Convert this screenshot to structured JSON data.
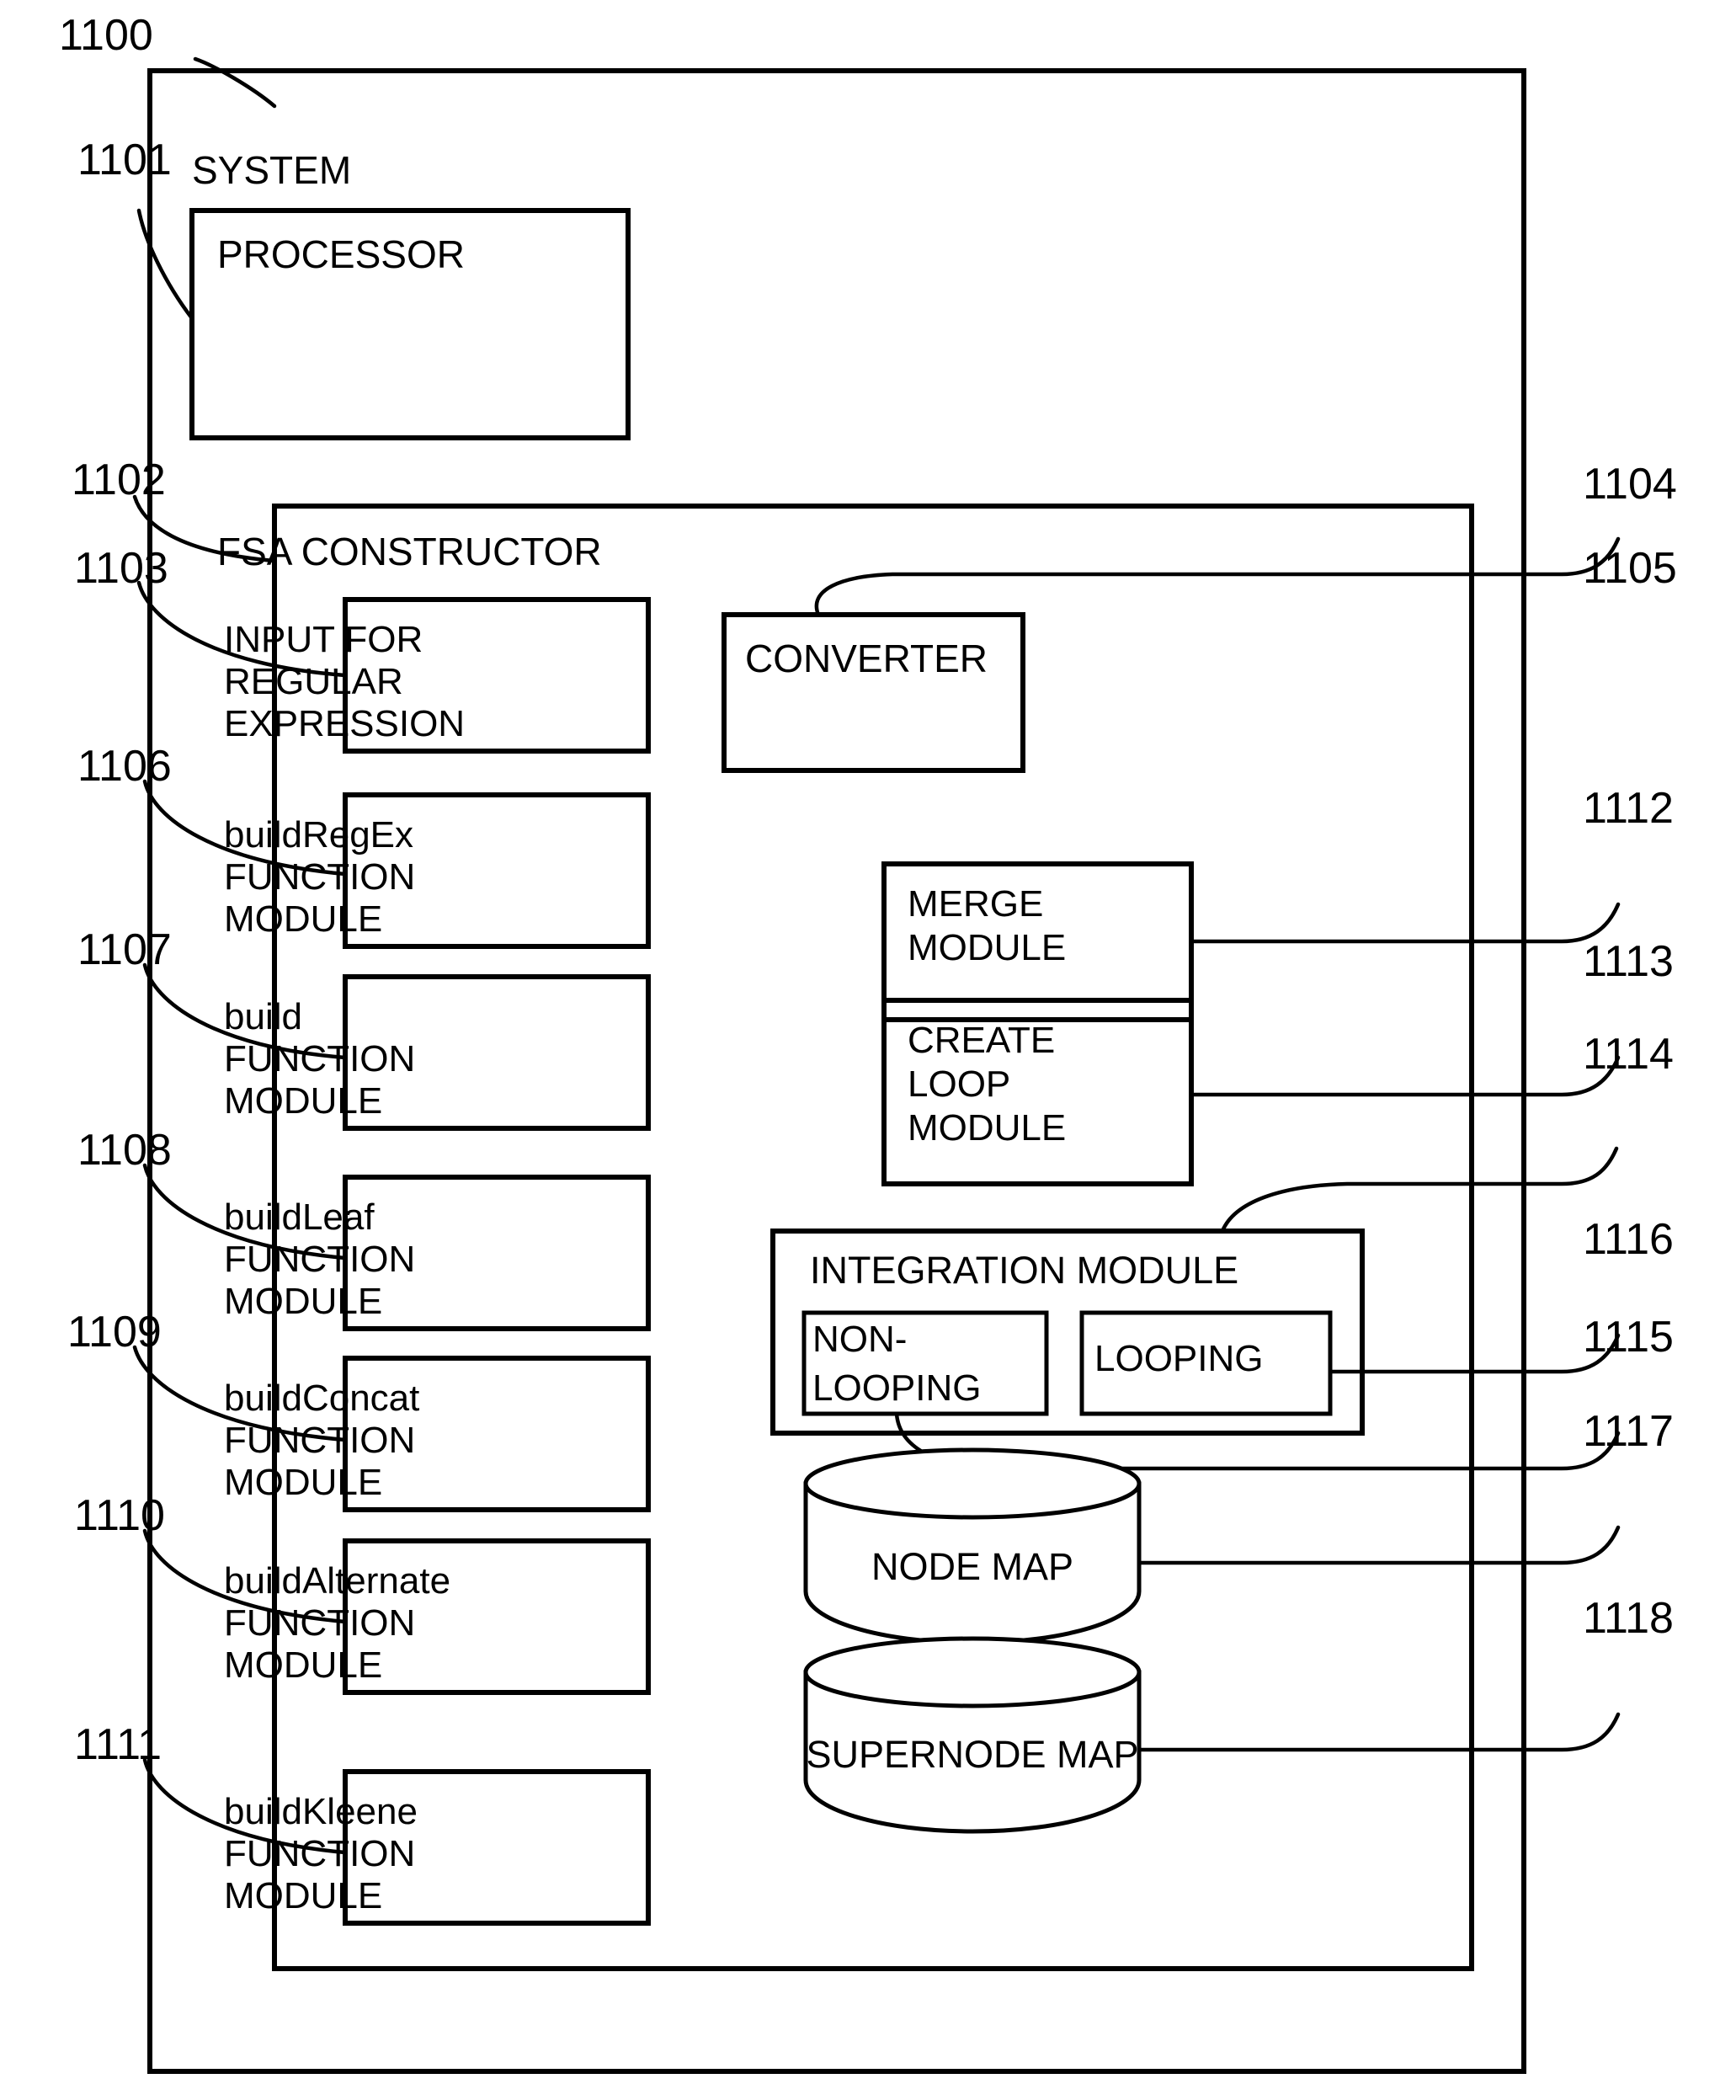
{
  "figure": {
    "type": "patent-block-diagram",
    "figure_number_label": "1100"
  },
  "outer": {
    "ref": "1100",
    "title": "SYSTEM"
  },
  "processor": {
    "ref": "1101",
    "title": "PROCESSOR"
  },
  "fsa_constructor": {
    "ref": "1102",
    "title": "FSA CONSTRUCTOR"
  },
  "left_column": [
    {
      "ref": "1103",
      "lines": [
        "INPUT FOR",
        "REGULAR",
        "EXPRESSION"
      ]
    },
    {
      "ref": "1106",
      "lines": [
        "buildRegEx",
        "FUNCTION",
        "MODULE"
      ]
    },
    {
      "ref": "1107",
      "lines": [
        "build",
        "FUNCTION",
        "MODULE"
      ]
    },
    {
      "ref": "1108",
      "lines": [
        "buildLeaf",
        "FUNCTION",
        "MODULE"
      ]
    },
    {
      "ref": "1109",
      "lines": [
        "buildConcat",
        "FUNCTION",
        "MODULE"
      ]
    },
    {
      "ref": "1110",
      "lines": [
        "buildAlternate",
        "FUNCTION",
        "MODULE"
      ]
    },
    {
      "ref": "1111",
      "lines": [
        "buildKleene",
        "FUNCTION",
        "MODULE"
      ]
    }
  ],
  "right_column": [
    {
      "ref": "1104",
      "lines": [
        "CONVERTER"
      ]
    },
    {
      "ref": "1112",
      "lines": [
        "MERGE",
        "MODULE"
      ]
    },
    {
      "ref": "1113",
      "lines": [
        "CREATE",
        "LOOP",
        "MODULE"
      ]
    }
  ],
  "integration_module": {
    "ref": "1114",
    "title": "INTEGRATION MODULE",
    "children": [
      {
        "ref": "1115",
        "lines": [
          "NON-",
          "LOOPING"
        ]
      },
      {
        "ref": "1116",
        "lines": [
          "LOOPING"
        ]
      }
    ]
  },
  "data_stores": [
    {
      "ref": "1117",
      "label": "NODE MAP"
    },
    {
      "ref": "1118",
      "label": "SUPERNODE MAP"
    }
  ],
  "unattached_refs": [
    {
      "ref": "1105"
    }
  ],
  "reference_numerals": [
    "1100",
    "1101",
    "1102",
    "1103",
    "1104",
    "1105",
    "1106",
    "1107",
    "1108",
    "1109",
    "1110",
    "1111",
    "1112",
    "1113",
    "1114",
    "1115",
    "1116",
    "1117",
    "1118"
  ],
  "colors": {
    "ink": "#000000",
    "paper": "#ffffff"
  }
}
